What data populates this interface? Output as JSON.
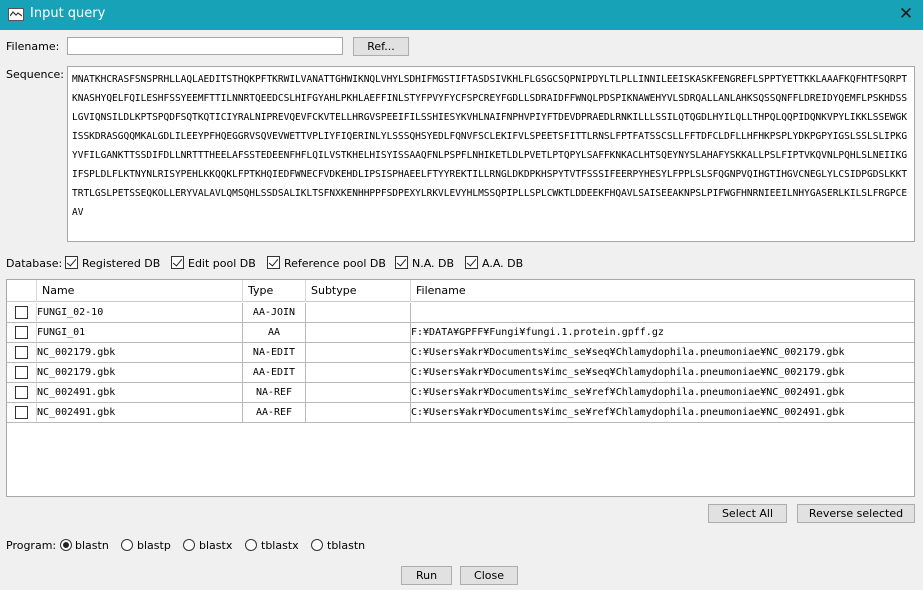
{
  "window": {
    "title": "Input query",
    "icon": "app-window-icon",
    "close_icon": "close-icon"
  },
  "filename": {
    "label": "Filename:",
    "value": "",
    "ref_button": "Ref..."
  },
  "sequence": {
    "label": "Sequence:",
    "value": "MNATKHCRASFSNSPRHLLAQLAEDITSTHQKPFTKRWILVANATTGHWIKNQLVHYLSDHIFMGSTIFTASDSIVKHLFLGSGCSQPNIPDYLTLPLLINNILEEISKASKFENGREFLSPPTYETTKKLAAAFKQFHTFSQRPTKNASHYQELFQILESHFSSYEEMFTTILNNRTQEEDCSLHIFGYAHLPKHLAEFFINLSTYFPVYFYCFSPCREYFGDLLSDRAIDFFWNQLPDSPIKNAWEHYVLSDRQALLANLAHKSQSSQNFFLDREIDYQEMFLPSKHDSSLGVIQNSILDLKPTSPQDFSQTKQTICIYRALNIPREVQEVFCKVTELLHRGVSPEEIFILSSHIESYKVHLNAIFNPHVPIYFTDEVDPRAEDLRNKILLLSSILQTQGDLHYILQLLTHPQLQQPIDQNKVPYLIKKLSSEWGKISSKDRASGQQMKALGDLILEEYPFHQEGGRVSQVEVWETTVPLIYFIQERINLYLSSSQHSYEDLFQNVFSCLEKIFVLSPEETSFITTLRNSLFPTFATSSCSLLFFTDFCLDFLLHFHKPSPLYDKPGPYIGSLSSLSLIPKGYVFILGANKTTSSDIFDLLNRTTTHEELAFSSTEDEENFHFLQILVSTKHELHISYISSAAQFNLPSPFLNHIKETLDLPVETLPTQPYLSAFFKNKACLHTSQEYNYSLAHAFYSKKALLPSLFIPTVKQVNLPQHLSLNEIIKGIFSPLDLFLKTNYNLRISYPEHLKKQQKLFPTKHQIEDFWNECFVDKEHDLIPSISPHAEELFTYYREKTILLRNGLDKDPKHSPYTVTFSSSIFEERPYHESYLFPPLSLSFQGNPVQIHGTIHGVCNEGLYLCSIDPGDSLKKTTRTLGSLPETSSEQKOLLERYVALAVLQMSQHLSSDSALIKLTSFNXKENHHPPFSDPEXYLRKVLEVYHLMSSQPIPLLSPLCWKTLDDEEKFHQAVLSAISEEAKNPSLPIFWGFHNRNIEEILNHYGASERLKILSLFRGPCEAV"
  },
  "database": {
    "label": "Database:",
    "options": [
      {
        "label": "Registered DB",
        "checked": true
      },
      {
        "label": "Edit pool DB",
        "checked": true
      },
      {
        "label": "Reference pool DB",
        "checked": true
      },
      {
        "label": "N.A. DB",
        "checked": true
      },
      {
        "label": "A.A. DB",
        "checked": true
      }
    ]
  },
  "table": {
    "columns": [
      "",
      "Name",
      "Type",
      "Subtype",
      "Filename"
    ],
    "rows": [
      {
        "checked": false,
        "name": "FUNGI_02-10",
        "type": "AA-JOIN",
        "subtype": "",
        "filename": ""
      },
      {
        "checked": false,
        "name": "FUNGI_01",
        "type": "AA",
        "subtype": "",
        "filename": "F:¥DATA¥GPFF¥Fungi¥fungi.1.protein.gpff.gz"
      },
      {
        "checked": false,
        "name": "NC_002179.gbk",
        "type": "NA-EDIT",
        "subtype": "",
        "filename": "C:¥Users¥akr¥Documents¥imc_se¥seq¥Chlamydophila.pneumoniae¥NC_002179.gbk"
      },
      {
        "checked": false,
        "name": "NC_002179.gbk",
        "type": "AA-EDIT",
        "subtype": "",
        "filename": "C:¥Users¥akr¥Documents¥imc_se¥seq¥Chlamydophila.pneumoniae¥NC_002179.gbk"
      },
      {
        "checked": false,
        "name": "NC_002491.gbk",
        "type": "NA-REF",
        "subtype": "",
        "filename": "C:¥Users¥akr¥Documents¥imc_se¥ref¥Chlamydophila.pneumoniae¥NC_002491.gbk"
      },
      {
        "checked": false,
        "name": "NC_002491.gbk",
        "type": "AA-REF",
        "subtype": "",
        "filename": "C:¥Users¥akr¥Documents¥imc_se¥ref¥Chlamydophila.pneumoniae¥NC_002491.gbk"
      }
    ]
  },
  "buttons": {
    "select_all": "Select All",
    "reverse_selected": "Reverse selected",
    "run": "Run",
    "close": "Close"
  },
  "program": {
    "label": "Program:",
    "options": [
      {
        "label": "blastn",
        "selected": true
      },
      {
        "label": "blastp",
        "selected": false
      },
      {
        "label": "blastx",
        "selected": false
      },
      {
        "label": "tblastx",
        "selected": false
      },
      {
        "label": "tblastn",
        "selected": false
      }
    ]
  },
  "colors": {
    "titlebar": "#17a2b8",
    "background": "#f0f0f0",
    "button": "#e1e1e1"
  }
}
